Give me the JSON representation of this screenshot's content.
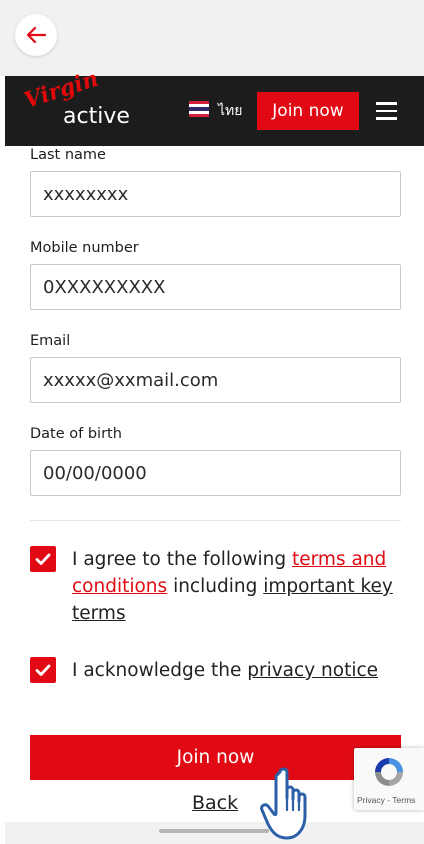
{
  "header": {
    "brand_virgin": "Virgin",
    "brand_active": "active",
    "language_label": "ไทย",
    "join_button_label": "Join now"
  },
  "form": {
    "last_name": {
      "label": "Last name",
      "value": "xxxxxxxx"
    },
    "mobile": {
      "label": "Mobile number",
      "value": "0XXXXXXXXX"
    },
    "email": {
      "label": "Email",
      "value": "xxxxx@xxmail.com"
    },
    "dob": {
      "label": "Date of birth",
      "value": "00/00/0000"
    }
  },
  "consents": {
    "terms": {
      "checked": true,
      "text_before": "I agree to the following ",
      "link_terms": "terms and conditions",
      "text_middle": " including ",
      "link_key_terms": "important key terms"
    },
    "privacy": {
      "checked": true,
      "text_before": "I acknowledge the ",
      "link_privacy": "privacy notice"
    }
  },
  "actions": {
    "join_label": "Join now",
    "back_label": "Back"
  },
  "recaptcha": {
    "privacy": "Privacy",
    "separator": " - ",
    "terms": "Terms"
  },
  "colors": {
    "brand_red": "#e10a14",
    "header_bg": "#1c1c1c",
    "topbar_bg": "#f1f1f1"
  },
  "icons": [
    "back-arrow-icon",
    "thai-flag-icon",
    "hamburger-menu-icon",
    "checkmark-icon",
    "recaptcha-icon",
    "hand-pointer-icon"
  ]
}
